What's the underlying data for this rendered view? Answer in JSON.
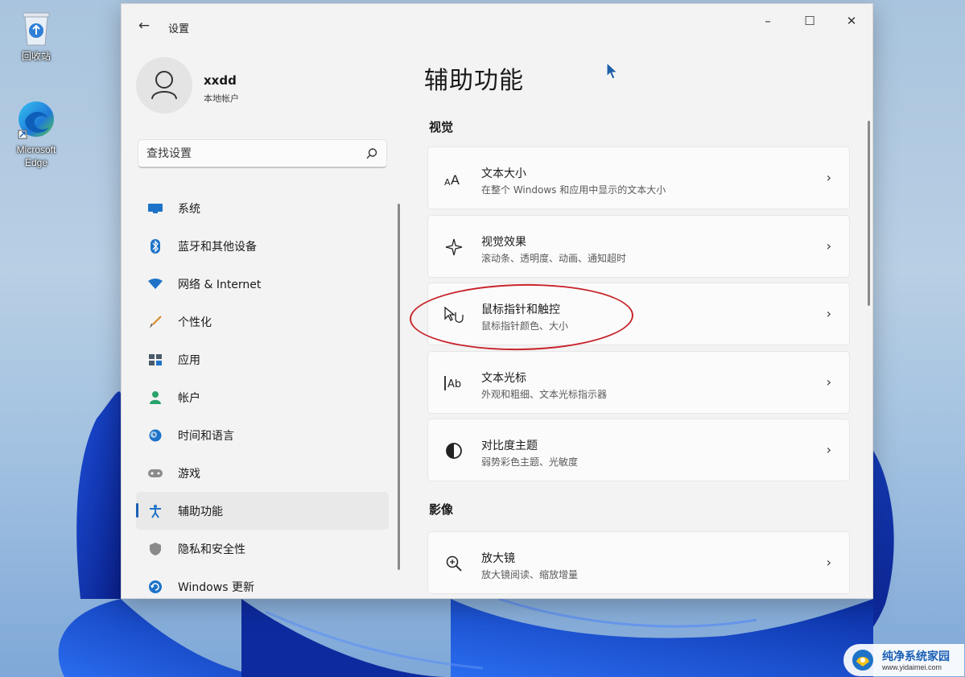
{
  "desktop": {
    "icons": [
      {
        "label": "回收站",
        "icon": "recycle-bin-icon"
      },
      {
        "label": "Microsoft Edge",
        "icon": "edge-icon"
      }
    ]
  },
  "window": {
    "title": "设置",
    "controls": {
      "minimize": "–",
      "maximize": "☐",
      "close": "✕"
    }
  },
  "profile": {
    "name": "xxdd",
    "account_type": "本地帐户"
  },
  "search": {
    "placeholder": "查找设置",
    "value": ""
  },
  "sidebar": {
    "items": [
      {
        "label": "系统",
        "icon": "monitor-icon",
        "color": "#1e73c8"
      },
      {
        "label": "蓝牙和其他设备",
        "icon": "bluetooth-icon",
        "color": "#1e73c8"
      },
      {
        "label": "网络 & Internet",
        "icon": "wifi-icon",
        "color": "#1e73c8"
      },
      {
        "label": "个性化",
        "icon": "brush-icon",
        "color": "#d98a2b"
      },
      {
        "label": "应用",
        "icon": "apps-icon",
        "color": "#4a5a6a"
      },
      {
        "label": "帐户",
        "icon": "person-icon",
        "color": "#2aa36b"
      },
      {
        "label": "时间和语言",
        "icon": "globe-clock-icon",
        "color": "#1e73c8"
      },
      {
        "label": "游戏",
        "icon": "gamepad-icon",
        "color": "#7a7a7a"
      },
      {
        "label": "辅助功能",
        "icon": "accessibility-icon",
        "color": "#1e73c8",
        "active": true
      },
      {
        "label": "隐私和安全性",
        "icon": "shield-icon",
        "color": "#7a7a7a"
      },
      {
        "label": "Windows 更新",
        "icon": "update-icon",
        "color": "#1e73c8"
      }
    ]
  },
  "main": {
    "title": "辅助功能",
    "sections": [
      {
        "header": "视觉",
        "cards": [
          {
            "title": "文本大小",
            "subtitle": "在整个 Windows 和应用中显示的文本大小",
            "icon": "text-size-icon"
          },
          {
            "title": "视觉效果",
            "subtitle": "滚动条、透明度、动画、通知超时",
            "icon": "sparkle-icon"
          },
          {
            "title": "鼠标指针和触控",
            "subtitle": "鼠标指针颜色、大小",
            "icon": "pointer-touch-icon",
            "highlighted": true
          },
          {
            "title": "文本光标",
            "subtitle": "外观和粗细、文本光标指示器",
            "icon": "text-cursor-icon"
          },
          {
            "title": "对比度主题",
            "subtitle": "弱势彩色主题、光敏度",
            "icon": "contrast-icon"
          }
        ]
      },
      {
        "header": "影像",
        "cards": [
          {
            "title": "放大镜",
            "subtitle": "放大镜阅读、缩放增量",
            "icon": "magnifier-icon"
          }
        ]
      }
    ]
  },
  "watermark": {
    "name": "纯净系统家园",
    "url": "www.yidaimei.com"
  },
  "colors": {
    "accent": "#1a5fb4",
    "highlight_ellipse": "#c8252b",
    "window_bg": "#f3f3f3",
    "card_bg": "#fbfbfb"
  }
}
